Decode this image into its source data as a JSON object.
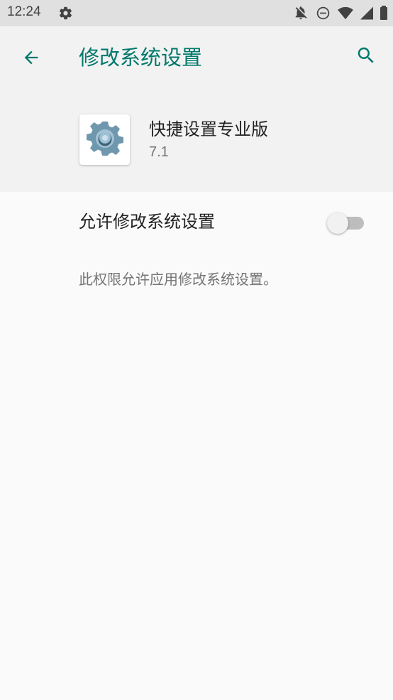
{
  "status_bar": {
    "time": "12:24",
    "icons": [
      "settings-gear-icon",
      "notifications-off-icon",
      "do-not-disturb-icon",
      "wifi-icon",
      "cell-signal-icon"
    ]
  },
  "app_bar": {
    "title": "修改系统设置",
    "back_icon": "arrow-back-icon",
    "search_icon": "search-icon",
    "accent_color": "#00796b"
  },
  "app_info": {
    "name": "快捷设置专业版",
    "version": "7.1",
    "icon": "gear-app-icon"
  },
  "setting": {
    "label": "允许修改系统设置",
    "enabled": false,
    "summary": "此权限允许应用修改系统设置。"
  }
}
